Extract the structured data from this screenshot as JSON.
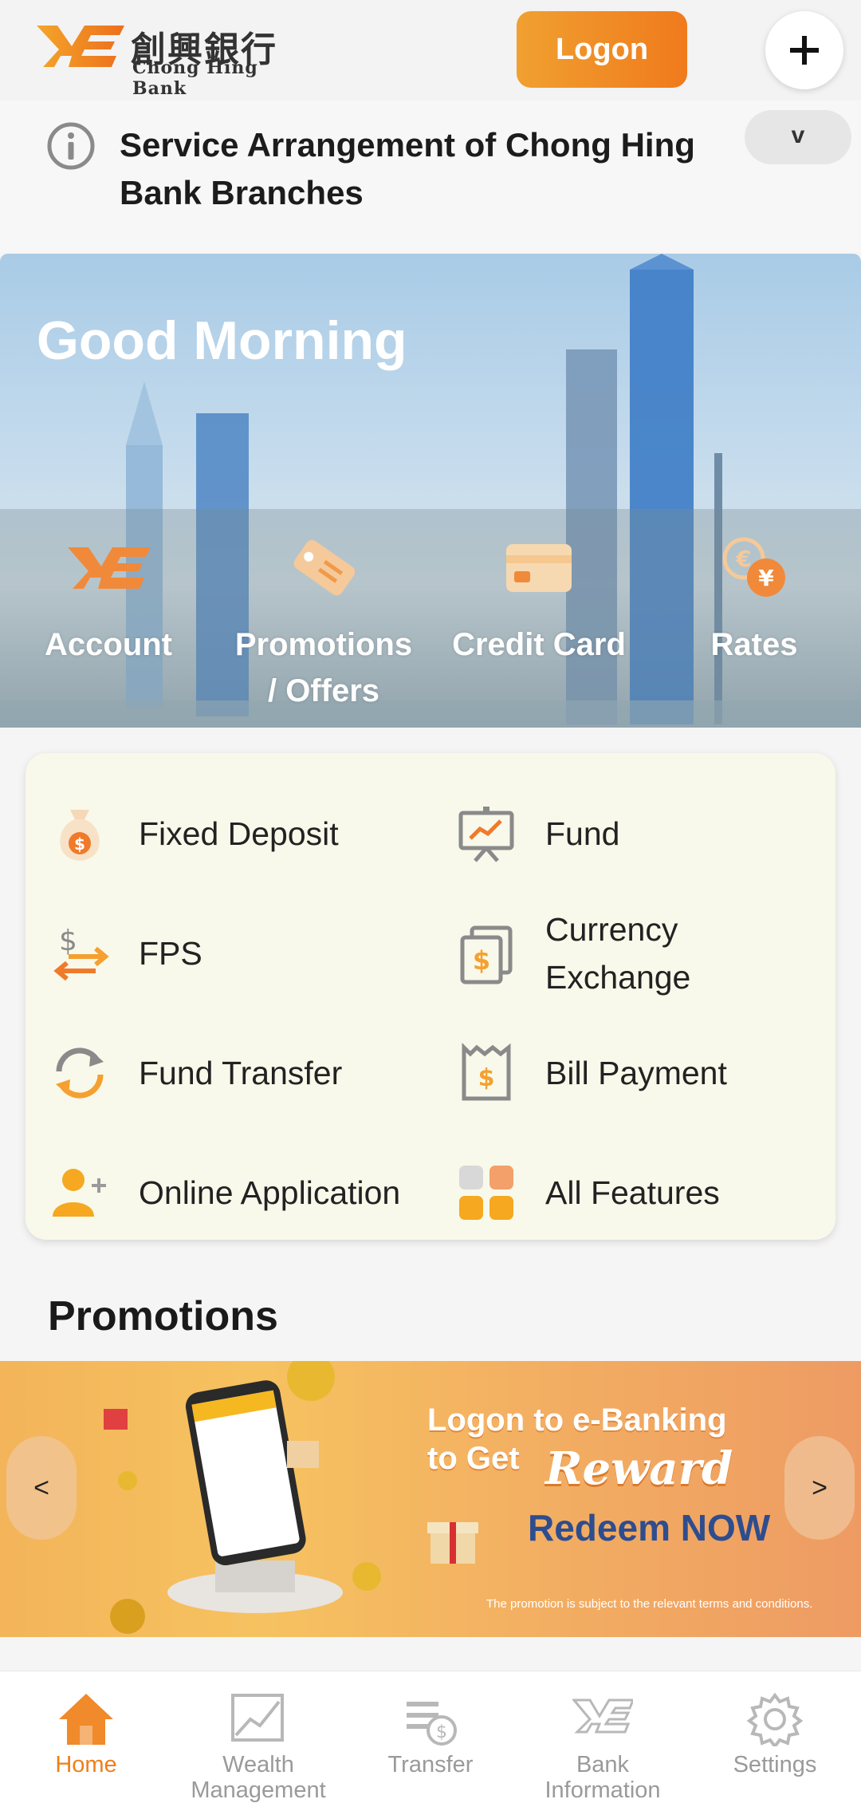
{
  "header": {
    "logo_zh": "創興銀行",
    "logo_en": "Chong Hing Bank",
    "logon_label": "Logon",
    "plus_label": "+"
  },
  "notice": {
    "text": "Service Arrangement of Chong Hing Bank Branches",
    "toggle_label": "v"
  },
  "hero": {
    "greeting": "Good Morning",
    "quick_links": [
      {
        "label": "Account",
        "icon": "bank-logo-icon"
      },
      {
        "label": "Promotions / Offers",
        "icon": "tag-icon"
      },
      {
        "label": "Credit Card",
        "icon": "credit-card-icon"
      },
      {
        "label": "Rates",
        "icon": "currency-rates-icon"
      }
    ]
  },
  "features": [
    {
      "label": "Fixed Deposit",
      "icon": "money-bag-icon"
    },
    {
      "label": "Fund",
      "icon": "chart-board-icon"
    },
    {
      "label": "FPS",
      "icon": "fps-transfer-icon"
    },
    {
      "label": "Currency Exchange",
      "icon": "currency-exchange-icon"
    },
    {
      "label": "Fund Transfer",
      "icon": "refresh-arrows-icon"
    },
    {
      "label": "Bill Payment",
      "icon": "bill-icon"
    },
    {
      "label": "Online Application",
      "icon": "add-user-icon"
    },
    {
      "label": "All Features",
      "icon": "grid-icon"
    }
  ],
  "promotions": {
    "title": "Promotions",
    "banner": {
      "line1": "Logon to e-Banking",
      "line2": "to Get",
      "reward": "Reward",
      "cta": "Redeem NOW",
      "terms": "The promotion is subject to the relevant terms and conditions."
    },
    "prev_label": "<",
    "next_label": ">"
  },
  "bottom_nav": [
    {
      "label": "Home",
      "icon": "home-icon",
      "active": true
    },
    {
      "label": "Wealth Management",
      "icon": "wealth-chart-icon",
      "active": false
    },
    {
      "label": "Transfer",
      "icon": "transfer-icon",
      "active": false
    },
    {
      "label": "Bank Information",
      "icon": "bank-info-icon",
      "active": false
    },
    {
      "label": "Settings",
      "icon": "settings-gear-icon",
      "active": false
    }
  ],
  "colors": {
    "brand_orange": "#ef7f1a",
    "feature_panel_bg": "#f8f9ea",
    "inactive_nav": "#9a9a9a",
    "redeem_blue": "#2e4d8f"
  }
}
